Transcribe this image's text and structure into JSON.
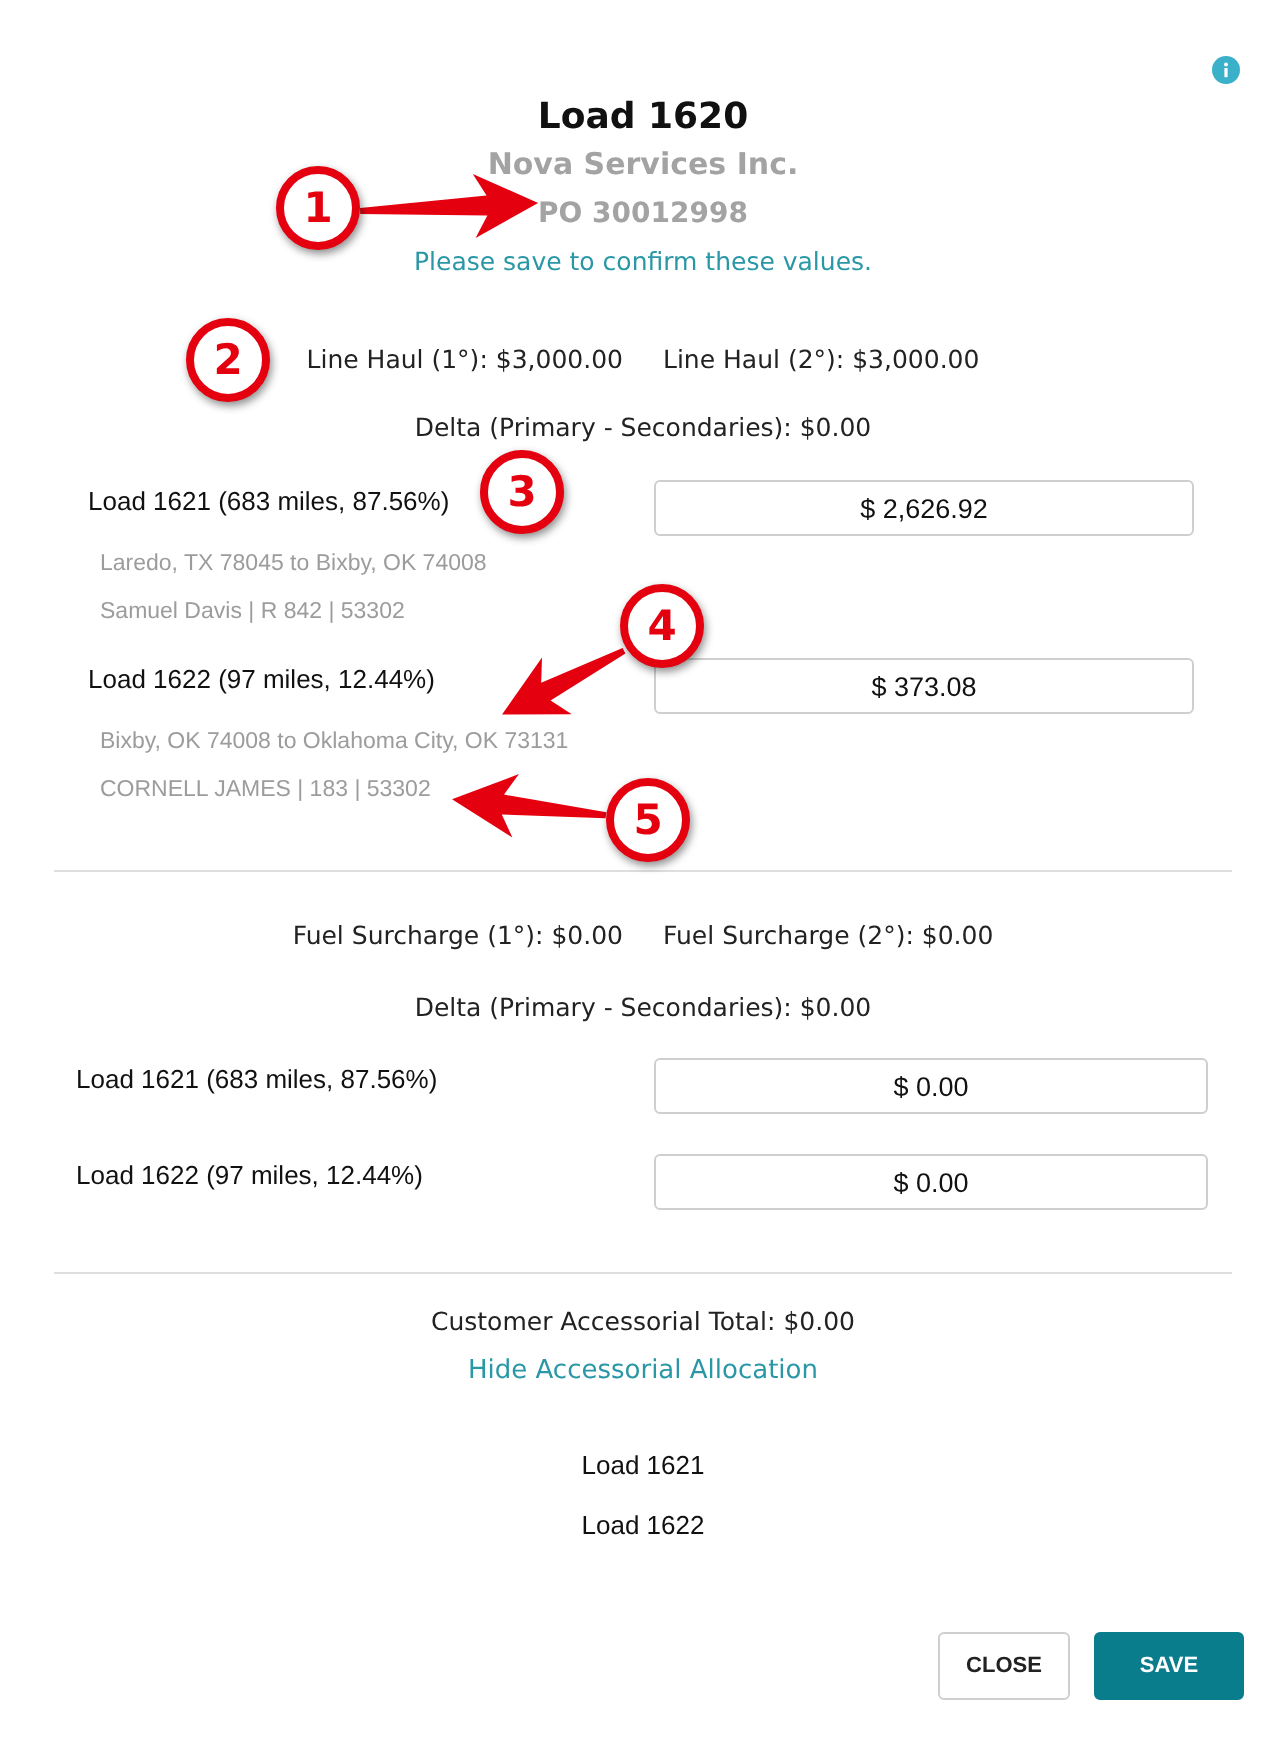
{
  "header": {
    "title": "Load 1620",
    "customer": "Nova Services Inc.",
    "po": "PO 30012998",
    "notice": "Please save to confirm these values."
  },
  "line_haul": {
    "totals": [
      "Line Haul (1°): $3,000.00",
      "Line Haul (2°): $3,000.00"
    ],
    "delta": "Delta (Primary - Secondaries): $0.00",
    "allocations": [
      {
        "label": "Load 1621 (683 miles, 87.56%)",
        "value": "$ 2,626.92",
        "route": "Laredo, TX 78045 to Bixby, OK 74008",
        "driver": "Samuel Davis | R 842 | 53302"
      },
      {
        "label": "Load 1622 (97 miles, 12.44%)",
        "value": "$ 373.08",
        "route": "Bixby, OK 74008 to Oklahoma City, OK 73131",
        "driver": "CORNELL JAMES | 183 | 53302"
      }
    ]
  },
  "fuel_surcharge": {
    "totals": [
      "Fuel Surcharge (1°): $0.00",
      "Fuel Surcharge (2°): $0.00"
    ],
    "delta": "Delta (Primary - Secondaries): $0.00",
    "allocations": [
      {
        "label": "Load 1621 (683 miles, 87.56%)",
        "value": "$ 0.00"
      },
      {
        "label": "Load 1622 (97 miles, 12.44%)",
        "value": "$ 0.00"
      }
    ]
  },
  "accessorials": {
    "total": "Customer Accessorial Total: $0.00",
    "toggle_link": "Hide Accessorial Allocation",
    "loads": [
      "Load 1621",
      "Load 1622"
    ]
  },
  "buttons": [
    {
      "label": "CLOSE",
      "kind": "secondary"
    },
    {
      "label": "SAVE",
      "kind": "primary"
    }
  ],
  "callouts": [
    {
      "number": "1",
      "kind": "arrow"
    },
    {
      "number": "2",
      "kind": "plain"
    },
    {
      "number": "3",
      "kind": "plain"
    },
    {
      "number": "4",
      "kind": "arrow"
    },
    {
      "number": "5",
      "kind": "arrow"
    }
  ]
}
